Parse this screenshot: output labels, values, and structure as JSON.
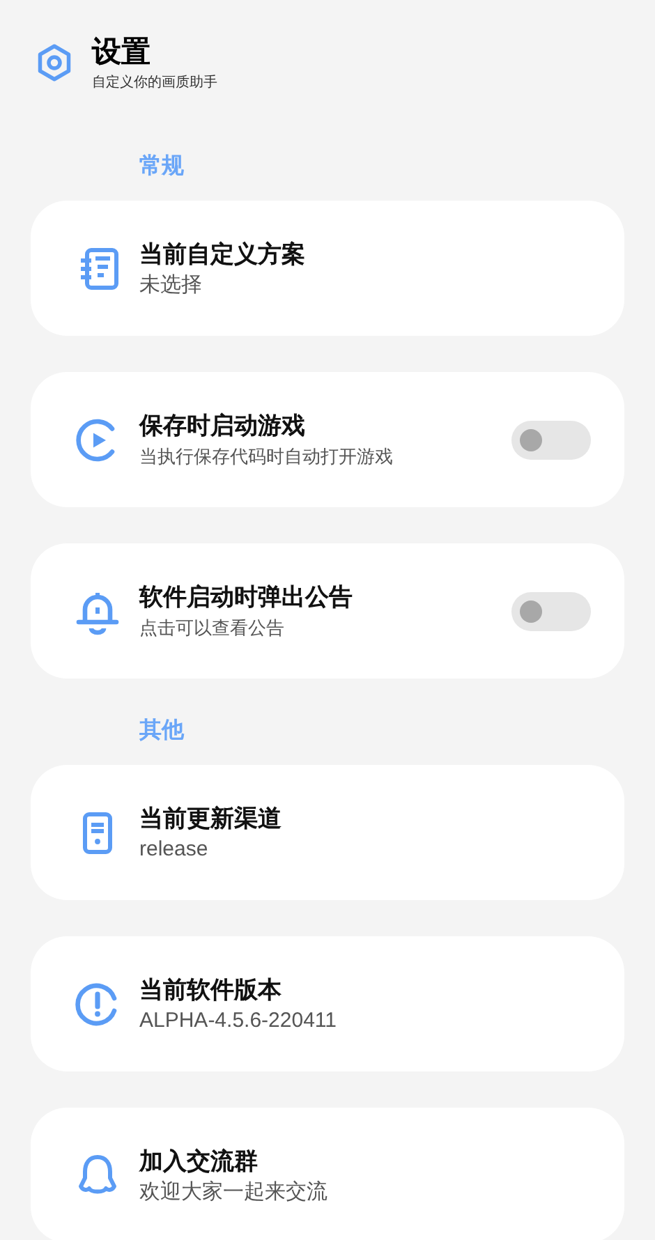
{
  "header": {
    "title": "设置",
    "subtitle": "自定义你的画质助手"
  },
  "sections": [
    {
      "heading": "常规",
      "items": [
        {
          "kind": "info",
          "title": "当前自定义方案",
          "subtitle": "未选择"
        },
        {
          "kind": "toggle",
          "title": "保存时启动游戏",
          "subtitle": "当执行保存代码时自动打开游戏",
          "on": false
        },
        {
          "kind": "toggle",
          "title": "软件启动时弹出公告",
          "subtitle": "点击可以查看公告",
          "on": false
        }
      ]
    },
    {
      "heading": "其他",
      "items": [
        {
          "kind": "info",
          "title": "当前更新渠道",
          "subtitle": "release"
        },
        {
          "kind": "info",
          "title": "当前软件版本",
          "subtitle": "ALPHA-4.5.6-220411"
        },
        {
          "kind": "info",
          "title": "加入交流群",
          "subtitle": "欢迎大家一起来交流"
        }
      ]
    }
  ]
}
